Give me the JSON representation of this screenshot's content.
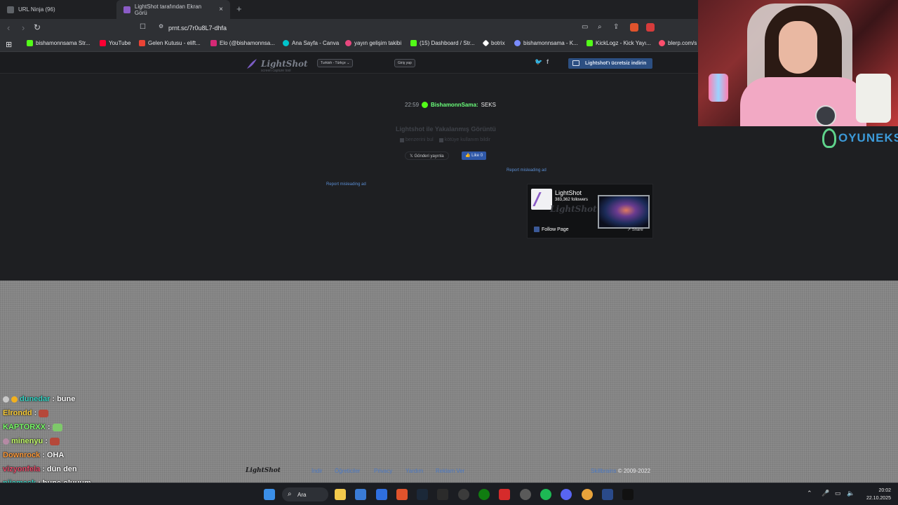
{
  "browser": {
    "tabs": [
      {
        "label": "URL Ninja (96)"
      },
      {
        "label": "LightShot tarafından Ekran Görü",
        "close": "×"
      }
    ],
    "new_tab": "+",
    "url": "prnt.sc/7r0u8L7-dhfa",
    "bookmarks": [
      {
        "label": "bishamonnsama Str...",
        "color": "#53fc18"
      },
      {
        "label": "YouTube",
        "color": "#ff0033"
      },
      {
        "label": "Gelen Kutusu - elift...",
        "color": "#ea4335"
      },
      {
        "label": "Elo (@bishamonnsa...",
        "color": "#d62976"
      },
      {
        "label": "Ana Sayfa - Canva",
        "color": "#00c4cc"
      },
      {
        "label": "yayın gelişim takibi",
        "color": "#e8477e"
      },
      {
        "label": "(15) Dashboard / Str...",
        "color": "#53fc18"
      },
      {
        "label": "botrix",
        "color": "#ffffff"
      },
      {
        "label": "bishamonnsama - K...",
        "color": "#7a8cff"
      },
      {
        "label": "KickLogz - Kick Yayı...",
        "color": "#53fc18"
      },
      {
        "label": "blerp.com/s",
        "color": "#ff4f6d"
      }
    ]
  },
  "site": {
    "logo": "LightShot",
    "logo_tagline": "screen capture tool",
    "language": "Turkish - Türkçe ⌄",
    "login": "Giriş yap",
    "download": "Lightshot'ı ücretsiz indirin",
    "chat_time": "22:59",
    "chat_user": "BishamonnSama:",
    "chat_text": "SEKS",
    "caption_title": "Lightshot ile Yakalanmış Görüntü",
    "find_similar": "benzerini bul",
    "report_abuse": "kötüye kullanım bildir",
    "tweet": "𝕏 Gönderi yayınla",
    "like": "👍 Like 0",
    "report_ad": "Report misleading ad",
    "fb_page": {
      "name": "LightShot",
      "followers": "383,362 followers",
      "watermark": "LightShot",
      "follow": "Follow Page",
      "share": "↗ Share"
    },
    "footer": {
      "logo": "LightShot",
      "links": [
        "İndir",
        "Öğreticiler",
        "Privacy",
        "Yardım",
        "Reklam Ver"
      ],
      "brand": "Skillbrains",
      "copyright": "© 2009-2022"
    }
  },
  "stream_chat": [
    {
      "user": "dunedar",
      "sep": ":",
      "text": "bune",
      "color": "#3bd6c6"
    },
    {
      "user": "Elrondd",
      "sep": ":",
      "text": "",
      "color": "#ffd13b"
    },
    {
      "user": "KAPTORXX",
      "sep": ":",
      "text": "",
      "color": "#7cff6b"
    },
    {
      "user": "minenyu",
      "sep": ":",
      "text": "",
      "color": "#c6ff6b"
    },
    {
      "user": "Downrock",
      "sep": ":",
      "text": "OHA",
      "color": "#ff9b3b"
    },
    {
      "user": "vizyonfela",
      "sep": ":",
      "text": "dün den",
      "color": "#e84c6a"
    },
    {
      "user": "pijamask",
      "sep": ":",
      "text": "bune oluuum",
      "color": "#3bd6c6"
    }
  ],
  "overlay": {
    "brand": "OYUNEKS"
  },
  "taskbar": {
    "search": "Ara",
    "time": "20:02",
    "date": "22.10.2025"
  }
}
